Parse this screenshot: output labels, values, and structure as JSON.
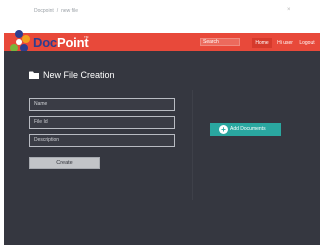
{
  "breadcrumb": {
    "root": "Docpoint",
    "separator": "/",
    "current": "new file"
  },
  "header": {
    "logo_text_part1": "Doc",
    "logo_text_part2": "Point",
    "logo_mark": "TM",
    "search_placeholder": "Search",
    "nav": {
      "home": "Home",
      "user": "Hi user",
      "logout": "Logout"
    },
    "colors": {
      "navbar": "#e8493a",
      "logo_text": "#2c3e8f"
    }
  },
  "main": {
    "title": "New File Creation",
    "fields": {
      "name_placeholder": "Name",
      "id_placeholder": "File Id",
      "desc_placeholder": "Description"
    },
    "create_label": "Create",
    "add_docs_label": "Add Documents",
    "colors": {
      "background": "#353740",
      "accent": "#2aa7a0"
    }
  },
  "icons": {
    "folder": "folder-icon",
    "plus": "plus-circle-icon",
    "corner": "close-icon"
  }
}
